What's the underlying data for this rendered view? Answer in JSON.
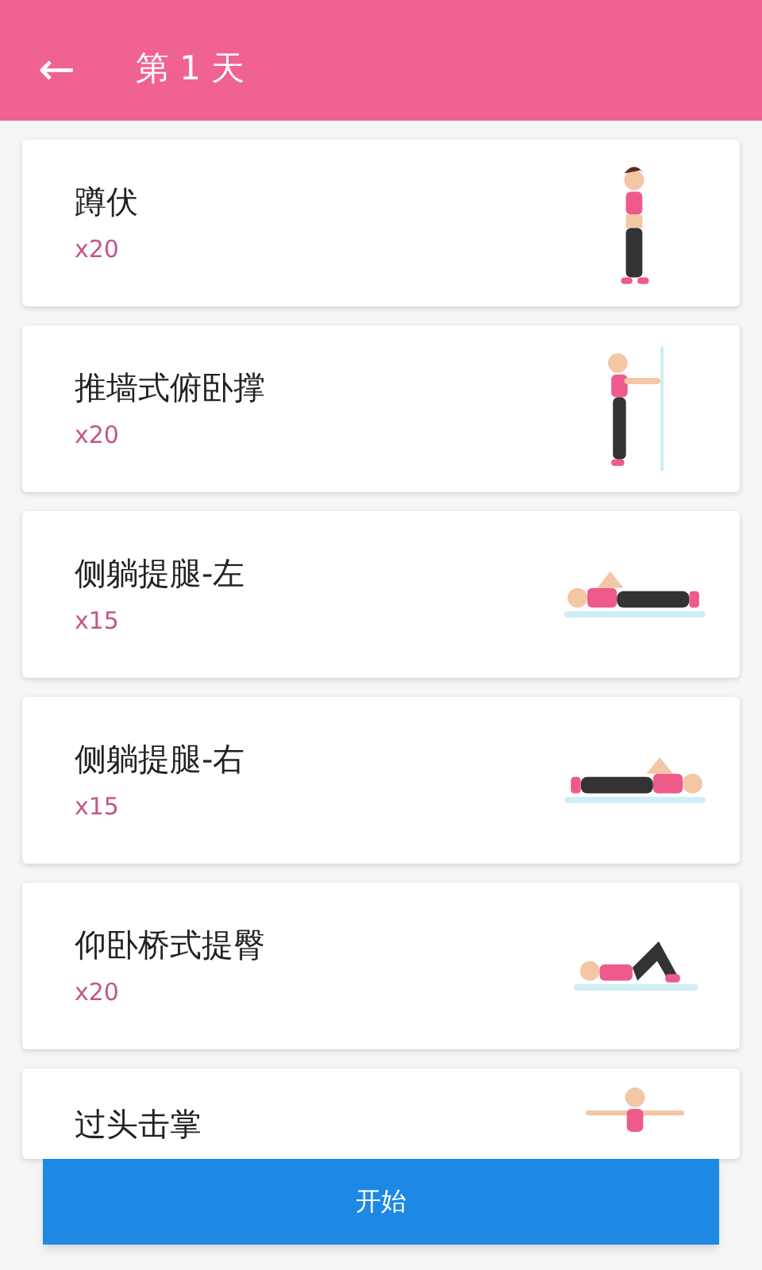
{
  "header": {
    "back": "←",
    "title": "第 1 天"
  },
  "exercises": [
    {
      "name": "蹲伏",
      "reps": "x20"
    },
    {
      "name": "推墙式俯卧撑",
      "reps": "x20"
    },
    {
      "name": "侧躺提腿-左",
      "reps": "x15"
    },
    {
      "name": "侧躺提腿-右",
      "reps": "x15"
    },
    {
      "name": "仰卧桥式提臀",
      "reps": "x20"
    },
    {
      "name": "过头击掌"
    }
  ],
  "start_button": "开始"
}
